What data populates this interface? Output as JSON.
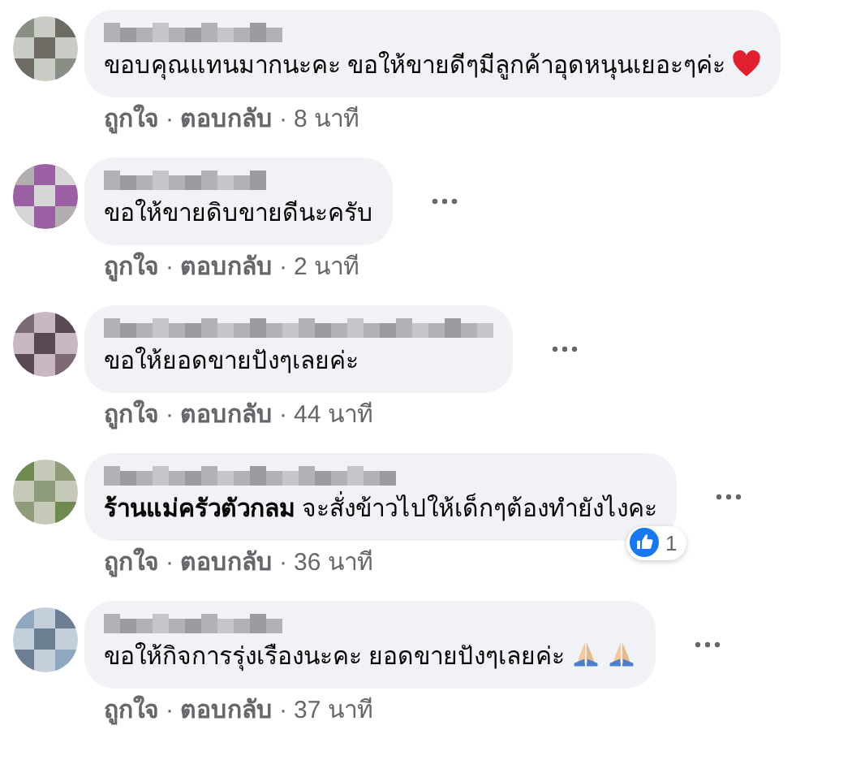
{
  "comments": [
    {
      "text": "ขอบคุณแทนมากนะคะ ขอให้ขายดีๆมีลูกค้าอุดหนุนเยอะๆค่ะ",
      "emojis": [
        {
          "kind": "heart"
        }
      ],
      "menu": false,
      "actions": [
        {
          "kind": "link",
          "text": "ถูกใจ"
        },
        {
          "kind": "separator",
          "text": "·"
        },
        {
          "kind": "link",
          "text": "ตอบกลับ"
        },
        {
          "kind": "separator",
          "text": "·"
        },
        {
          "kind": "time",
          "text": "8 นาที"
        }
      ]
    },
    {
      "text": "ขอให้ขายดิบขายดีนะครับ",
      "menu": true,
      "actions": [
        {
          "kind": "link",
          "text": "ถูกใจ"
        },
        {
          "kind": "separator",
          "text": "·"
        },
        {
          "kind": "link",
          "text": "ตอบกลับ"
        },
        {
          "kind": "separator",
          "text": "·"
        },
        {
          "kind": "time",
          "text": "2 นาที"
        }
      ]
    },
    {
      "text": "ขอให้ยอดขายปังๆเลยค่ะ",
      "menu": true,
      "actions": [
        {
          "kind": "link",
          "text": "ถูกใจ"
        },
        {
          "kind": "separator",
          "text": "·"
        },
        {
          "kind": "link",
          "text": "ตอบกลับ"
        },
        {
          "kind": "separator",
          "text": "·"
        },
        {
          "kind": "time",
          "text": "44 นาที"
        }
      ]
    },
    {
      "text": "**ร้านแม่ครัวตัวกลม** จะสั่งข้าวไปให้เด็กๆต้องทำยังไงคะ",
      "menu": true,
      "reactions": "1",
      "actions": [
        {
          "kind": "link",
          "text": "ถูกใจ"
        },
        {
          "kind": "separator",
          "text": "·"
        },
        {
          "kind": "link",
          "text": "ตอบกลับ"
        },
        {
          "kind": "separator",
          "text": "·"
        },
        {
          "kind": "time",
          "text": "36 นาที"
        }
      ]
    },
    {
      "text": "ขอให้กิจการรุ่งเรืองนะคะ ยอดขายปังๆเลยค่ะ",
      "emojis": [
        {
          "kind": "pray"
        },
        {
          "kind": "pray"
        }
      ],
      "menu": true,
      "actions": [
        {
          "kind": "link",
          "text": "ถูกใจ"
        },
        {
          "kind": "separator",
          "text": "·"
        },
        {
          "kind": "link",
          "text": "ตอบกลับ"
        },
        {
          "kind": "separator",
          "text": "·"
        },
        {
          "kind": "time",
          "text": "37 นาที"
        }
      ]
    }
  ]
}
